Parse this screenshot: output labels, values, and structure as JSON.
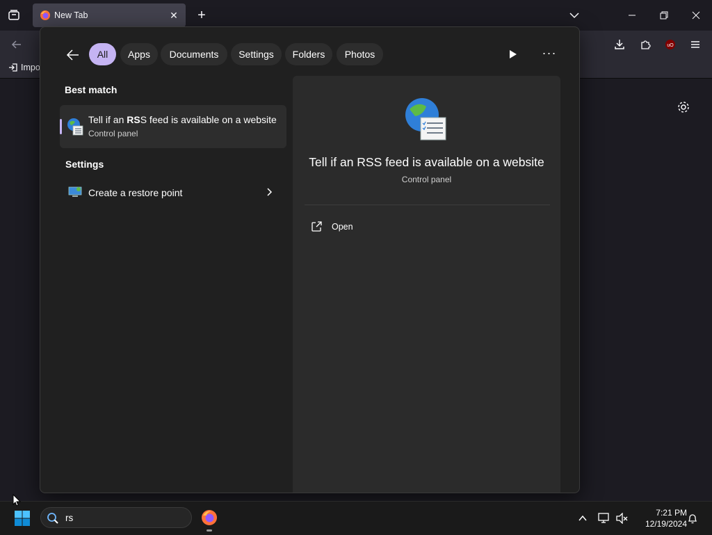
{
  "browser": {
    "tab_title": "New Tab",
    "bookmark_import_label": "Impo"
  },
  "search": {
    "filters": [
      "All",
      "Apps",
      "Documents",
      "Settings",
      "Folders",
      "Photos"
    ],
    "active_filter": "All",
    "best_match_heading": "Best match",
    "best_match": {
      "title_prefix": "Tell if an ",
      "title_bold": "RS",
      "title_suffix": "S feed is available on a website",
      "subtitle": "Control panel"
    },
    "settings_heading": "Settings",
    "settings_items": [
      {
        "label": "Create a restore point"
      }
    ],
    "preview": {
      "title": "Tell if an RSS feed is available on a website",
      "subtitle": "Control panel",
      "actions": [
        {
          "label": "Open"
        }
      ]
    }
  },
  "taskbar": {
    "search_value": "rs",
    "time": "7:21 PM",
    "date": "12/19/2024"
  },
  "colors": {
    "accent": "#c5b4f3",
    "flyout_bg": "#202020",
    "preview_bg": "#2b2b2b",
    "browser_bg": "#1c1b22"
  },
  "icons": {
    "tab_list": "tab-list-icon",
    "firefox": "firefox-icon",
    "back": "arrow-left-icon",
    "play": "play-icon",
    "more": "more-icon",
    "globe_checklist": "globe-checklist-icon",
    "restore_point": "restore-point-icon",
    "chevron": "chevron-right-icon",
    "open": "open-external-icon",
    "windows_start": "windows-logo-icon",
    "search": "search-icon",
    "settings_gear": "gear-icon"
  }
}
